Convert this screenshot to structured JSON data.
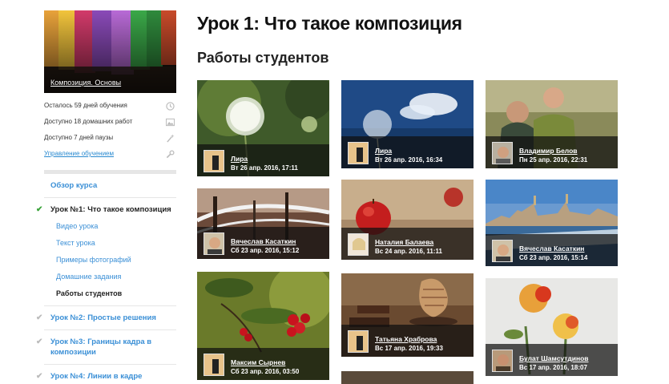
{
  "sidebar": {
    "course_link": "Композиция. Основы",
    "stats": [
      {
        "label": "Осталось 59 дней обучения",
        "icon": "clock-icon"
      },
      {
        "label": "Доступно 18 домашних работ",
        "icon": "image-icon"
      },
      {
        "label": "Доступно 7 дней паузы",
        "icon": "wand-icon"
      },
      {
        "label": "Управление обучением",
        "icon": "wrench-icon"
      }
    ],
    "nav": {
      "overview": "Обзор курса",
      "lesson1": "Урок №1: Что такое композиция",
      "lesson1_items": [
        "Видео урока",
        "Текст урока",
        "Примеры фотографий",
        "Домашние задания",
        "Работы студентов"
      ],
      "lesson2": "Урок №2: Простые решения",
      "lesson3": "Урок №3: Границы кадра в композиции",
      "lesson4": "Урок №4: Линии в кадре"
    }
  },
  "main": {
    "title": "Урок 1: Что такое композиция",
    "section": "Работы студентов",
    "works": [
      {
        "author": "Лира",
        "date": "Вт 26 апр. 2016, 17:11"
      },
      {
        "author": "Лира",
        "date": "Вт 26 апр. 2016, 16:34"
      },
      {
        "author": "Владимир Белов",
        "date": "Пн 25 апр. 2016, 22:31"
      },
      {
        "author": "Вячеслав Касаткин",
        "date": "Сб 23 апр. 2016, 15:12"
      },
      {
        "author": "Наталия Балаева",
        "date": "Вс 24 апр. 2016, 11:11"
      },
      {
        "author": "Вячеслав Касаткин",
        "date": "Сб 23 апр. 2016, 15:14"
      },
      {
        "author": "Максим Сырнев",
        "date": "Сб 23 апр. 2016, 03:50"
      },
      {
        "author": "Татьяна Храброва",
        "date": "Вс 17 апр. 2016, 19:33"
      },
      {
        "author": "Булат Шамсутдинов",
        "date": "Вс 17 апр. 2016, 18:07"
      }
    ]
  },
  "colors": {
    "link": "#3a8fd6",
    "check_active": "#3aa33a",
    "check_inactive": "#bbbbbb"
  }
}
